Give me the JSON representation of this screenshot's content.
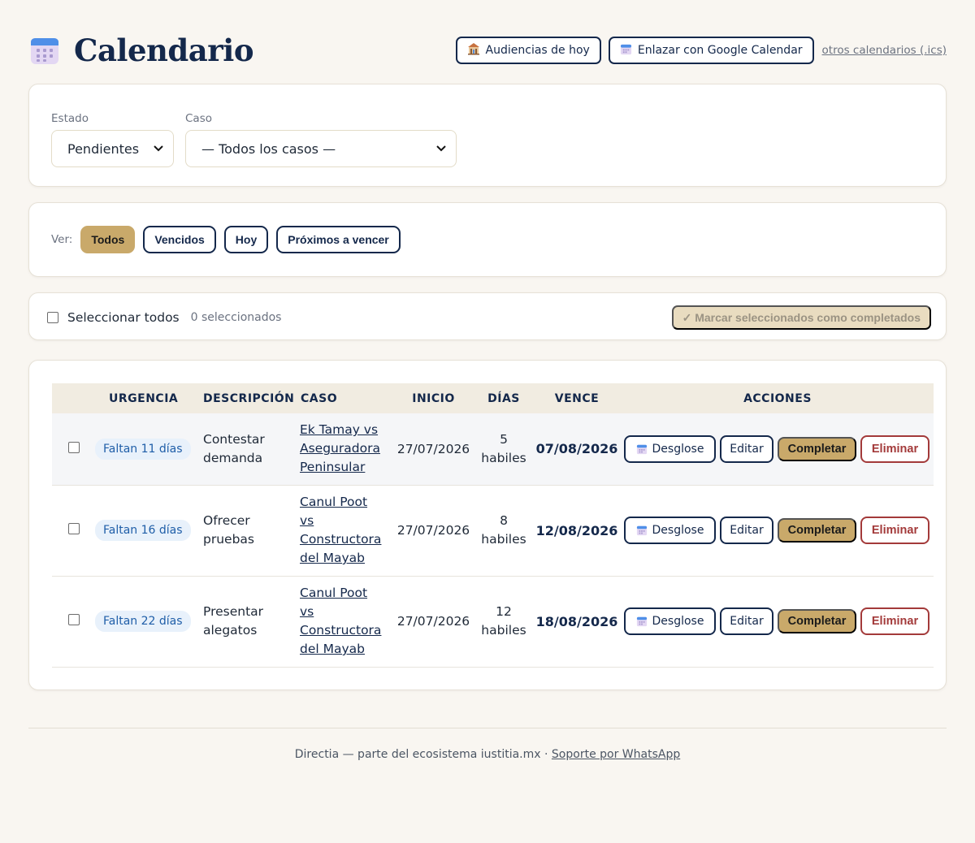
{
  "header": {
    "title": "Calendario",
    "today_hearings": "Audiencias de hoy",
    "google_link": "Enlazar con Google Calendar",
    "other_calendars": "otros calendarios (.ics)"
  },
  "filters": {
    "estado_label": "Estado",
    "estado_value": "Pendientes",
    "caso_label": "Caso",
    "caso_value": "— Todos los casos —"
  },
  "view": {
    "label": "Ver:",
    "chips": [
      "Todos",
      "Vencidos",
      "Hoy",
      "Próximos a vencer"
    ],
    "active": "Todos"
  },
  "selection": {
    "select_all": "Seleccionar todos",
    "count_text": "0 seleccionados",
    "bulk_action": "✓ Marcar seleccionados como completados"
  },
  "table": {
    "headers": {
      "urgencia": "URGENCIA",
      "descripcion": "DESCRIPCIÓN",
      "caso": "CASO",
      "inicio": "INICIO",
      "dias": "DÍAS",
      "vence": "VENCE",
      "acciones": "ACCIONES"
    },
    "rows": [
      {
        "urgency": "Faltan 11 días",
        "desc_line1": "Contestar",
        "desc_line2": "demanda",
        "case_lines": [
          "Ek Tamay vs",
          "Aseguradora",
          "Peninsular"
        ],
        "start": "27/07/2026",
        "days_num": "5",
        "days_unit": "habiles",
        "due": "07/08/2026"
      },
      {
        "urgency": "Faltan 16 días",
        "desc_line1": "Ofrecer",
        "desc_line2": "pruebas",
        "case_lines": [
          "Canul Poot",
          "vs",
          "Constructora",
          "del Mayab"
        ],
        "start": "27/07/2026",
        "days_num": "8",
        "days_unit": "habiles",
        "due": "12/08/2026"
      },
      {
        "urgency": "Faltan 22 días",
        "desc_line1": "Presentar",
        "desc_line2": "alegatos",
        "case_lines": [
          "Canul Poot",
          "vs",
          "Constructora",
          "del Mayab"
        ],
        "start": "27/07/2026",
        "days_num": "12",
        "days_unit": "habiles",
        "due": "18/08/2026"
      }
    ],
    "actions": {
      "breakdown": "Desglose",
      "edit": "Editar",
      "complete": "Completar",
      "delete": "Eliminar"
    }
  },
  "footer": {
    "text": "Directia — parte del ecosistema iustitia.mx · ",
    "support_link": "Soporte por WhatsApp"
  },
  "colors": {
    "navy": "#14284b",
    "gold": "#c9a96a",
    "danger": "#a33a3a",
    "badge_bg": "#e8f1fb",
    "badge_text": "#1f5ea8",
    "page_bg": "#f9f6f1"
  },
  "icons": {
    "title": "calendar-icon",
    "hearings": "courthouse-icon",
    "google": "calendar-icon",
    "breakdown": "calendar-icon"
  }
}
